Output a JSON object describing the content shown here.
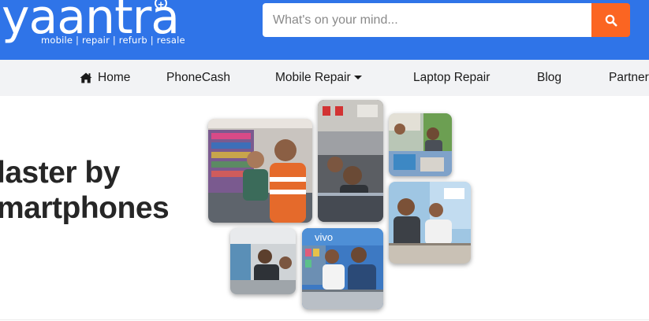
{
  "header": {
    "logo_text": "yaantra",
    "tagline": "mobile | repair | refurb | resale",
    "bg_color": "#2f74e8",
    "search": {
      "placeholder": "What's on your mind...",
      "button_icon": "search-icon",
      "button_color": "#fb6522"
    }
  },
  "nav": {
    "items": [
      {
        "label": "Home",
        "icon": "home-icon"
      },
      {
        "label": "PhoneCash"
      },
      {
        "label": "Mobile Repair",
        "icon": "caret-down-icon"
      },
      {
        "label": "Laptop Repair"
      },
      {
        "label": "Blog"
      },
      {
        "label": "Partner"
      }
    ]
  },
  "hero": {
    "headline_line1": "laster by",
    "headline_line2": "martphones",
    "photos": [
      "store-photo-1",
      "store-photo-2",
      "store-photo-3",
      "store-photo-4",
      "store-photo-5",
      "store-photo-6"
    ]
  }
}
